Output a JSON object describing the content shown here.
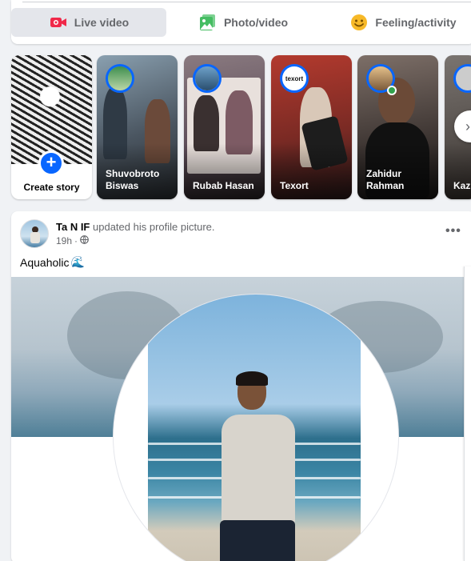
{
  "composer": {
    "actions": [
      {
        "label": "Live video",
        "icon": "live-video-icon",
        "color": "#f02849"
      },
      {
        "label": "Photo/video",
        "icon": "photo-video-icon",
        "color": "#45bd62"
      },
      {
        "label": "Feeling/activity",
        "icon": "feeling-activity-icon",
        "color": "#f7b928"
      }
    ]
  },
  "stories": {
    "create_label": "Create story",
    "items": [
      {
        "name": "Shuvobroto Biswas"
      },
      {
        "name": "Rubab Hasan"
      },
      {
        "name": "Texort",
        "avatar_text": "texort"
      },
      {
        "name": "Zahidur Rahman",
        "online": true
      },
      {
        "name": "Kazi"
      }
    ]
  },
  "post": {
    "author": "Ta N IF",
    "action": "updated his profile picture.",
    "time": "19h",
    "audience_icon": "public-globe-icon",
    "caption": "Aquaholic",
    "caption_emoji": "🌊"
  },
  "colors": {
    "accent": "#0866ff",
    "background": "#f0f2f5",
    "secondary_text": "#65676b"
  }
}
